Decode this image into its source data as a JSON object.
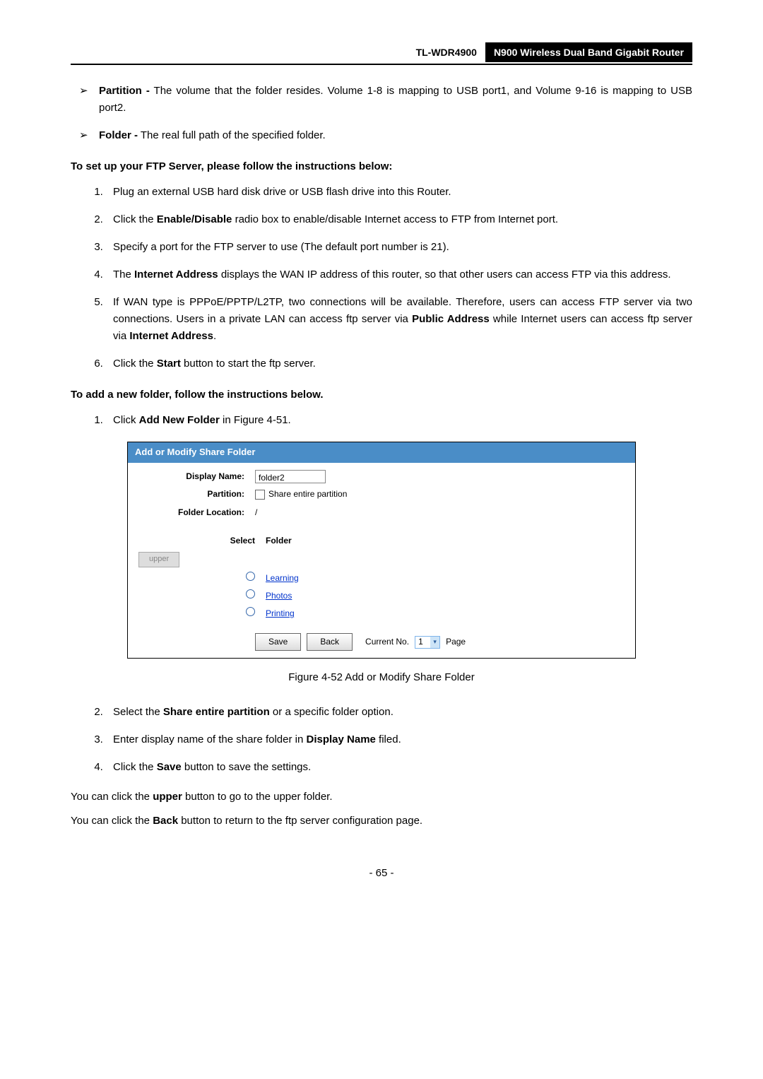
{
  "header": {
    "model": "TL-WDR4900",
    "product": "N900 Wireless Dual Band Gigabit Router"
  },
  "defs": {
    "partition": {
      "label": "Partition -",
      "text": " The volume that the folder resides. Volume 1-8 is mapping to USB port1, and Volume 9-16 is mapping to USB port2."
    },
    "folder": {
      "label": "Folder -",
      "text": " The real full path of the specified folder."
    }
  },
  "section1_title": "To set up your FTP Server, please follow the instructions below:",
  "steps1": [
    {
      "text": "Plug an external USB hard disk drive or USB flash drive into this Router."
    },
    {
      "pre": "Click the ",
      "b1": "Enable/Disable",
      "post": " radio box to enable/disable Internet access to FTP from Internet port."
    },
    {
      "text": "Specify a port for the FTP server to use (The default port number is 21)."
    },
    {
      "pre": "The ",
      "b1": "Internet Address",
      "post": " displays the WAN IP address of this router, so that other users can access FTP via this address."
    },
    {
      "pre": "If WAN type is PPPoE/PPTP/L2TP, two connections will be available. Therefore, users can access FTP server via two connections. Users in a private LAN can access ftp server via ",
      "b1": "Public Address",
      "mid": " while Internet users can access ftp server via ",
      "b2": "Internet Address",
      "post": "."
    },
    {
      "pre": "Click the ",
      "b1": "Start",
      "post": " button to start the ftp server."
    }
  ],
  "section2_title": "To add a new folder, follow the instructions below.",
  "steps2a": [
    {
      "pre": "Click ",
      "b1": "Add New Folder",
      "post": " in Figure 4-51."
    }
  ],
  "figure": {
    "title": "Add or Modify Share Folder",
    "display_name_label": "Display Name:",
    "display_name_value": "folder2",
    "partition_label": "Partition:",
    "partition_checkbox_label": "Share entire partition",
    "folder_location_label": "Folder Location:",
    "folder_location_value": "/",
    "select_header": "Select",
    "folder_header": "Folder",
    "upper_button": "upper",
    "folders": [
      "Learning",
      "Photos",
      "Printing"
    ],
    "save_btn": "Save",
    "back_btn": "Back",
    "current_no_label": "Current No.",
    "current_no_value": "1",
    "page_label": "Page"
  },
  "caption": "Figure 4-52 Add or Modify Share Folder",
  "steps2b": [
    {
      "pre": "Select the ",
      "b1": "Share entire partition",
      "post": " or a specific folder option."
    },
    {
      "pre": "Enter display name of the share folder in ",
      "b1": "Display Name",
      "post": " filed."
    },
    {
      "pre": "Click the ",
      "b1": "Save",
      "post": " button to save the settings."
    }
  ],
  "plain1": {
    "pre": "You can click the ",
    "b1": "upper",
    "post": " button to go to the upper folder."
  },
  "plain2": {
    "pre": "You can click the ",
    "b1": "Back",
    "post": " button to return to the ftp server configuration page."
  },
  "page_number": "- 65 -"
}
